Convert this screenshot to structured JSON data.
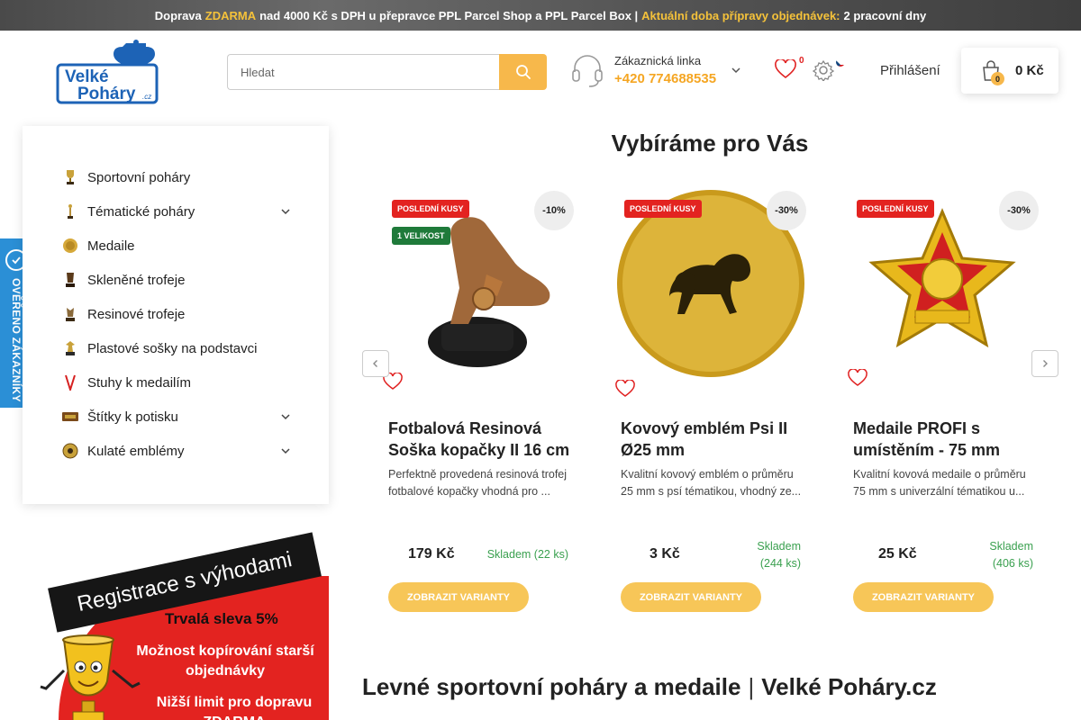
{
  "topbar": {
    "p1": "Doprava",
    "p2": "ZDARMA",
    "p3": "nad 4000 Kč s DPH u přepravce PPL Parcel Shop a PPL Parcel Box |",
    "p4": "Aktuální doba přípravy objednávek:",
    "p5": "2 pracovní dny"
  },
  "header": {
    "logo_line1": "Velké",
    "logo_line2": "Poháry",
    "logo_suffix": ".cz",
    "search_placeholder": "Hledat",
    "hotline_label": "Zákaznická linka",
    "hotline_phone": "+420 774688535",
    "wishlist_count": "0",
    "login_label": "Přihlášení",
    "cart_count": "0",
    "cart_total": "0 Kč"
  },
  "colors": {
    "accent": "#f7b84b",
    "stock_green": "#3aa04f",
    "badge_red": "#e32320",
    "badge_green": "#1f7a3a",
    "verified_blue": "#2b8fd6"
  },
  "sidebar": {
    "items": [
      {
        "label": "Sportovní poháry",
        "icon": "trophy-icon",
        "expandable": false
      },
      {
        "label": "Tématické poháry",
        "icon": "figure-trophy-icon",
        "expandable": true
      },
      {
        "label": "Medaile",
        "icon": "medal-icon",
        "expandable": false
      },
      {
        "label": "Skleněné trofeje",
        "icon": "glass-trophy-icon",
        "expandable": false
      },
      {
        "label": "Resinové trofeje",
        "icon": "resin-trophy-icon",
        "expandable": false
      },
      {
        "label": "Plastové sošky na podstavci",
        "icon": "statue-icon",
        "expandable": false
      },
      {
        "label": "Stuhy k medailím",
        "icon": "ribbon-icon",
        "expandable": false
      },
      {
        "label": "Štítky k potisku",
        "icon": "plate-icon",
        "expandable": true
      },
      {
        "label": "Kulaté emblémy",
        "icon": "emblem-icon",
        "expandable": true
      }
    ]
  },
  "verified_badge": "OVĚŘENO ZÁKAZNÍKY",
  "promo": {
    "title": "Registrace s výhodami",
    "line1": "Trvalá sleva 5%",
    "line2": "Možnost kopírování starší objednávky",
    "line3": "Nižší limit pro dopravu ZDARMA"
  },
  "section_title": "Vybíráme pro Vás",
  "products": [
    {
      "badges": [
        "POSLEDNÍ KUSY",
        "1 VELIKOST"
      ],
      "discount": "-10%",
      "name": "Fotbalová Resinová Soška kopačky II 16 cm",
      "desc": "Perfektně provedená resinová trofej fotbalové kopačky vhodná pro ...",
      "price": "179 Kč",
      "stock": "Skladem (22 ks)",
      "button": "ZOBRAZIT VARIANTY"
    },
    {
      "badges": [
        "POSLEDNÍ KUSY"
      ],
      "discount": "-30%",
      "name": "Kovový emblém Psi II Ø25 mm",
      "desc": "Kvalitní kovový emblém o průměru 25 mm s psí tématikou, vhodný ze...",
      "price": "3 Kč",
      "stock": "Skladem (244 ks)",
      "button": "ZOBRAZIT VARIANTY"
    },
    {
      "badges": [
        "POSLEDNÍ KUSY"
      ],
      "discount": "-30%",
      "name": "Medaile PROFI s umístěním - 75 mm",
      "desc": "Kvalitní kovová medaile o průměru 75 mm s univerzální tématikou u...",
      "price": "25 Kč",
      "stock": "Skladem (406 ks)",
      "button": "ZOBRAZIT VARIANTY"
    }
  ],
  "bottom_title": {
    "left": "Levné sportovní poháry a medaile",
    "sep": "|",
    "right": "Velké Poháry.cz"
  }
}
